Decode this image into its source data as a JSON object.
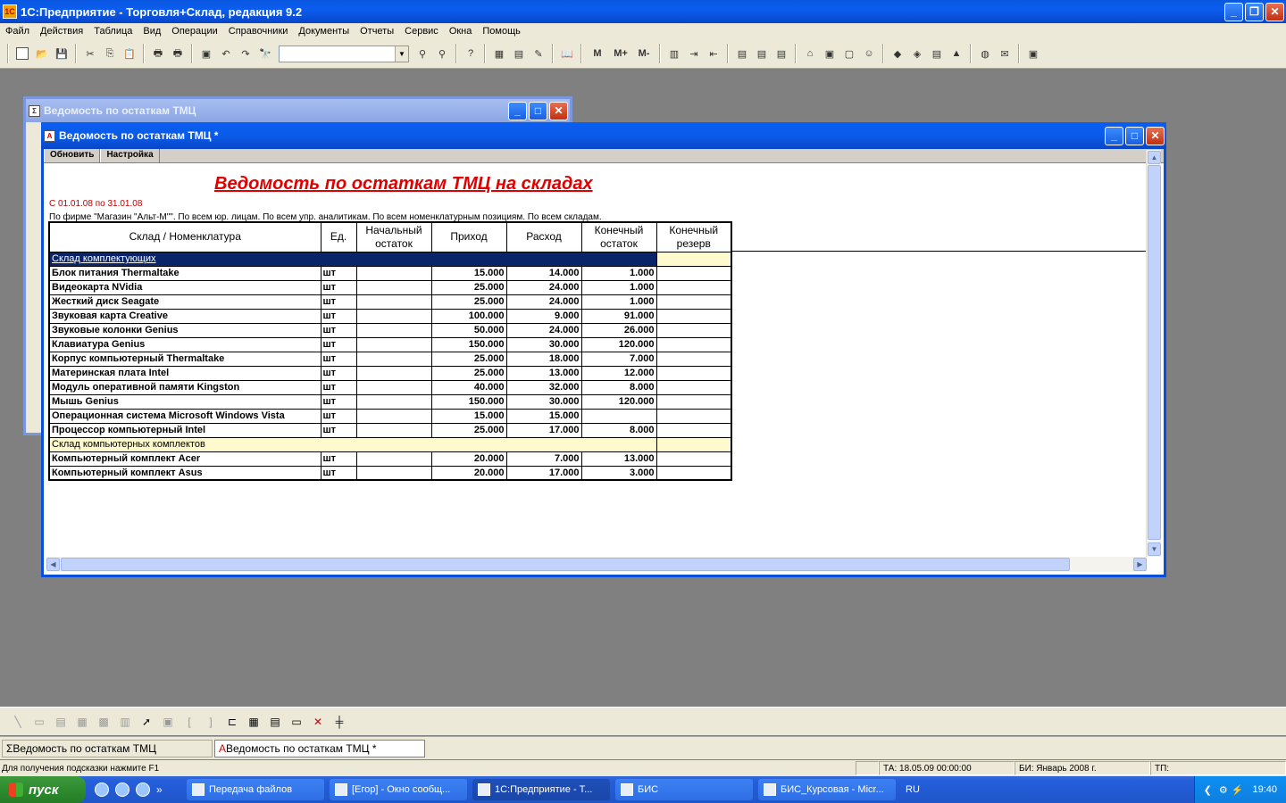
{
  "app": {
    "title": "1С:Предприятие - Торговля+Склад, редакция 9.2",
    "menu": [
      "Файл",
      "Действия",
      "Таблица",
      "Вид",
      "Операции",
      "Справочники",
      "Документы",
      "Отчеты",
      "Сервис",
      "Окна",
      "Помощь"
    ],
    "toolbar_labels": {
      "m": "M",
      "mplus": "M+",
      "mminus": "M-"
    },
    "search_value": ""
  },
  "back_window": {
    "title": "Ведомость по остаткам ТМЦ"
  },
  "front_window": {
    "title": "Ведомость по остаткам ТМЦ  *",
    "buttons": {
      "refresh": "Обновить",
      "settings": "Настройка"
    }
  },
  "report": {
    "title": "Ведомость по остаткам ТМЦ на складах",
    "period": "С 01.01.08 по 31.01.08",
    "filter": "По фирме \"Магазин \"Альт-М\"\". По всем юр. лицам. По всем упр. аналитикам. По всем номенклатурным позициям. По всем складам.",
    "columns": [
      "Склад / Номенклатура",
      "Ед.",
      "Начальный остаток",
      "Приход",
      "Расход",
      "Конечный остаток",
      "Конечный резерв"
    ],
    "groups": [
      {
        "name": "Склад комплектующих",
        "rows": [
          {
            "name": "Блок питания Thermaltake",
            "unit": "шт",
            "start": "",
            "in": "15.000",
            "out": "14.000",
            "end": "1.000",
            "reserve": ""
          },
          {
            "name": "Видеокарта NVidia",
            "unit": "шт",
            "start": "",
            "in": "25.000",
            "out": "24.000",
            "end": "1.000",
            "reserve": ""
          },
          {
            "name": "Жесткий диск Seagate",
            "unit": "шт",
            "start": "",
            "in": "25.000",
            "out": "24.000",
            "end": "1.000",
            "reserve": ""
          },
          {
            "name": "Звуковая карта Creative",
            "unit": "шт",
            "start": "",
            "in": "100.000",
            "out": "9.000",
            "end": "91.000",
            "reserve": ""
          },
          {
            "name": "Звуковые колонки Genius",
            "unit": "шт",
            "start": "",
            "in": "50.000",
            "out": "24.000",
            "end": "26.000",
            "reserve": ""
          },
          {
            "name": "Клавиатура Genius",
            "unit": "шт",
            "start": "",
            "in": "150.000",
            "out": "30.000",
            "end": "120.000",
            "reserve": ""
          },
          {
            "name": "Корпус компьютерный Thermaltake",
            "unit": "шт",
            "start": "",
            "in": "25.000",
            "out": "18.000",
            "end": "7.000",
            "reserve": ""
          },
          {
            "name": "Материнская плата Intel",
            "unit": "шт",
            "start": "",
            "in": "25.000",
            "out": "13.000",
            "end": "12.000",
            "reserve": ""
          },
          {
            "name": "Модуль оперативной памяти Kingston",
            "unit": "шт",
            "start": "",
            "in": "40.000",
            "out": "32.000",
            "end": "8.000",
            "reserve": ""
          },
          {
            "name": "Мышь Genius",
            "unit": "шт",
            "start": "",
            "in": "150.000",
            "out": "30.000",
            "end": "120.000",
            "reserve": ""
          },
          {
            "name": "Операционная система Microsoft Windows Vista",
            "unit": "шт",
            "start": "",
            "in": "15.000",
            "out": "15.000",
            "end": "",
            "reserve": ""
          },
          {
            "name": "Процессор компьютерный Intel",
            "unit": "шт",
            "start": "",
            "in": "25.000",
            "out": "17.000",
            "end": "8.000",
            "reserve": ""
          }
        ]
      },
      {
        "name": "Склад компьютерных комплектов",
        "rows": [
          {
            "name": "Компьютерный комплект Acer",
            "unit": "шт",
            "start": "",
            "in": "20.000",
            "out": "7.000",
            "end": "13.000",
            "reserve": ""
          },
          {
            "name": "Компьютерный комплект Asus",
            "unit": "шт",
            "start": "",
            "in": "20.000",
            "out": "17.000",
            "end": "3.000",
            "reserve": ""
          }
        ]
      }
    ]
  },
  "window_tabs": [
    "Ведомость по остаткам ТМЦ",
    "Ведомость по остаткам ТМЦ  *"
  ],
  "status": {
    "hint": "Для получения подсказки нажмите F1",
    "ta": "ТА: 18.05.09  00:00:00",
    "bi": "БИ: Январь 2008 г.",
    "tp": "ТП:"
  },
  "taskbar": {
    "start": "пуск",
    "tasks": [
      "Передача файлов",
      "[Егор] - Окно сообщ...",
      "1С:Предприятие - Т...",
      "БИС",
      "БИС_Курсовая - Micr..."
    ],
    "lang": "RU",
    "clock": "19:40"
  }
}
